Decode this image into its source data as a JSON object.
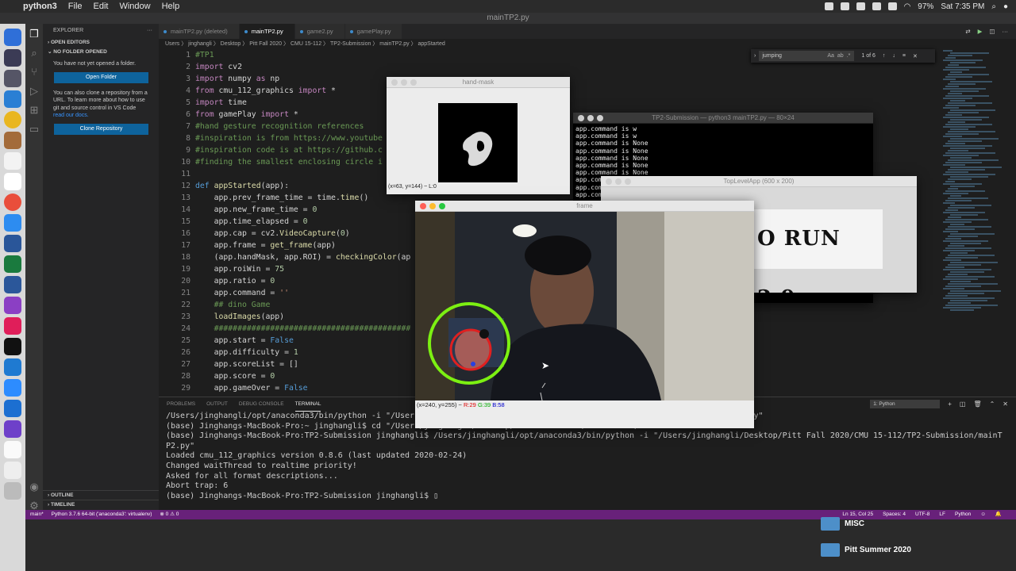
{
  "menubar": {
    "app": "python3",
    "items": [
      "File",
      "Edit",
      "Window",
      "Help"
    ],
    "battery": "97%",
    "clock": "Sat 7:35 PM"
  },
  "window_title": "mainTP2.py",
  "sidebar": {
    "title": "EXPLORER",
    "open_editors": "OPEN EDITORS",
    "no_folder": "NO FOLDER OPENED",
    "msg1": "You have not yet opened a folder.",
    "open_folder": "Open Folder",
    "msg2": "You can also clone a repository from a URL. To learn more about how to use git and source control in VS Code ",
    "msg2_link": "read our docs.",
    "clone": "Clone Repository",
    "outline": "OUTLINE",
    "timeline": "TIMELINE"
  },
  "tabs": [
    {
      "label": "mainTP2.py (deleted)"
    },
    {
      "label": "mainTP2.py"
    },
    {
      "label": "game2.py"
    },
    {
      "label": "gamePlay.py"
    }
  ],
  "breadcrumb": "Users 〉 jinghangli 〉 Desktop 〉 Pitt Fall 2020 〉 CMU 15-112 〉 TP2-Submission 〉 mainTP2.py 〉 appStarted",
  "find": {
    "query": "jumping",
    "count": "1 of 6",
    "case": "Aa",
    "word": "ab",
    "regex": ".*"
  },
  "line_numbers": [
    "1",
    "2",
    "3",
    "4",
    "5",
    "6",
    "7",
    "8",
    "9",
    "10",
    "11",
    "12",
    "13",
    "14",
    "15",
    "16",
    "17",
    "18",
    "19",
    "20",
    "21",
    "22",
    "23",
    "24",
    "25",
    "26",
    "27",
    "28",
    "29"
  ],
  "code": [
    [
      {
        "t": "#TP1",
        "c": "c"
      }
    ],
    [
      {
        "t": "import",
        "c": "k"
      },
      {
        "t": " cv2"
      }
    ],
    [
      {
        "t": "import",
        "c": "k"
      },
      {
        "t": " numpy "
      },
      {
        "t": "as",
        "c": "k"
      },
      {
        "t": " np"
      }
    ],
    [
      {
        "t": "from",
        "c": "k"
      },
      {
        "t": " cmu_112_graphics "
      },
      {
        "t": "import",
        "c": "k"
      },
      {
        "t": " *"
      }
    ],
    [
      {
        "t": "import",
        "c": "k"
      },
      {
        "t": " time"
      }
    ],
    [
      {
        "t": "from",
        "c": "k"
      },
      {
        "t": " gamePlay "
      },
      {
        "t": "import",
        "c": "k"
      },
      {
        "t": " *"
      }
    ],
    [
      {
        "t": "#hand gesture recognition references",
        "c": "c"
      }
    ],
    [
      {
        "t": "#inspiration is from https://www.youtube",
        "c": "c"
      }
    ],
    [
      {
        "t": "#inspiration code is at https://github.c",
        "c": "c"
      }
    ],
    [
      {
        "t": "#finding the smallest enclosing circle i",
        "c": "c"
      }
    ],
    [
      {
        "t": ""
      }
    ],
    [
      {
        "t": "def",
        "c": "kw"
      },
      {
        "t": " "
      },
      {
        "t": "appStarted",
        "c": "f"
      },
      {
        "t": "(app):"
      }
    ],
    [
      {
        "t": "    app.prev_frame_time = time."
      },
      {
        "t": "time",
        "c": "f"
      },
      {
        "t": "()"
      }
    ],
    [
      {
        "t": "    app.new_frame_time = "
      },
      {
        "t": "0",
        "c": "n"
      }
    ],
    [
      {
        "t": "    app.time_elapsed = "
      },
      {
        "t": "0",
        "c": "n"
      }
    ],
    [
      {
        "t": "    app.cap = cv2."
      },
      {
        "t": "VideoCapture",
        "c": "f"
      },
      {
        "t": "("
      },
      {
        "t": "0",
        "c": "n"
      },
      {
        "t": ")"
      }
    ],
    [
      {
        "t": "    app.frame = "
      },
      {
        "t": "get_frame",
        "c": "f"
      },
      {
        "t": "(app)"
      }
    ],
    [
      {
        "t": "    (app.handMask, app.ROI) = "
      },
      {
        "t": "checkingColor",
        "c": "f"
      },
      {
        "t": "(ap"
      }
    ],
    [
      {
        "t": "    app.roiWin = "
      },
      {
        "t": "75",
        "c": "n"
      }
    ],
    [
      {
        "t": "    app.ratio = "
      },
      {
        "t": "0",
        "c": "n"
      }
    ],
    [
      {
        "t": "    app.command = "
      },
      {
        "t": "''",
        "c": "s"
      }
    ],
    [
      {
        "t": "    ## dino Game",
        "c": "c"
      }
    ],
    [
      {
        "t": "    "
      },
      {
        "t": "loadImages",
        "c": "f"
      },
      {
        "t": "(app)"
      }
    ],
    [
      {
        "t": "    ##########################################",
        "c": "c"
      }
    ],
    [
      {
        "t": "    app.start = "
      },
      {
        "t": "False",
        "c": "kw"
      }
    ],
    [
      {
        "t": "    app.difficulty = "
      },
      {
        "t": "1",
        "c": "n"
      }
    ],
    [
      {
        "t": "    app.scoreList = []"
      }
    ],
    [
      {
        "t": "    app.score = "
      },
      {
        "t": "0",
        "c": "n"
      }
    ],
    [
      {
        "t": "    app.gameOver = "
      },
      {
        "t": "False",
        "c": "kw"
      }
    ]
  ],
  "panel": {
    "tabs": [
      "PROBLEMS",
      "OUTPUT",
      "DEBUG CONSOLE",
      "TERMINAL"
    ],
    "terminal_select": "1: Python"
  },
  "terminal": [
    "/Users/jinghangli/opt/anaconda3/bin/python -i \"/Users/jinghangli/Desktop/Pitt Fall 2020/CMU 15-112/TP2-Submission/mainTP2.py\"",
    "(base) Jinghangs-MacBook-Pro:~ jinghangli$ cd \"/Users/jinghangli/Desktop/Pitt Fall 2020/CMU 15-112/TP2-Submission\"",
    "(base) Jinghangs-MacBook-Pro:TP2-Submission jinghangli$ /Users/jinghangli/opt/anaconda3/bin/python -i \"/Users/jinghangli/Desktop/Pitt Fall 2020/CMU 15-112/TP2-Submission/mainT",
    "P2.py\"",
    "Loaded cmu_112_graphics version 0.8.6 (last updated 2020-02-24)",
    "Changed waitThread to realtime priority!",
    "Asked for all format descriptions...",
    "Abort trap: 6",
    "(base) Jinghangs-MacBook-Pro:TP2-Submission jinghangli$ ▯"
  ],
  "status": {
    "branch": "main*",
    "python": "Python 3.7.6 64-bit ('anaconda3': virtualenv)",
    "problems": "⊗ 0 ⚠ 0",
    "position": "Ln 15, Col 25",
    "spaces": "Spaces: 4",
    "encoding": "UTF-8",
    "eol": "LF",
    "lang": "Python"
  },
  "hand_mask": {
    "title": "hand-mask",
    "status": "(x=63, y=144) ~ L:0"
  },
  "terminal_window": {
    "title": "TP2-Submission — python3 mainTP2.py — 80×24",
    "lines": [
      "app.command is w",
      "app.command is w",
      "app.command is None",
      "app.command is None",
      "app.command is None",
      "app.command is None",
      "app.command is None",
      "app.com",
      "app.com",
      "app.com"
    ]
  },
  "toplevel": {
    "title": "TopLevelApp (600 x 200)",
    "banner": "O RUN 2.0"
  },
  "frame_window": {
    "title": "frame",
    "status_prefix": "(x=240, y=255) ~ ",
    "r": "R:29",
    "g": "G:39",
    "b": "B:58"
  },
  "desktop": {
    "folders": [
      "MISC",
      "Pitt Summer 2020"
    ]
  }
}
